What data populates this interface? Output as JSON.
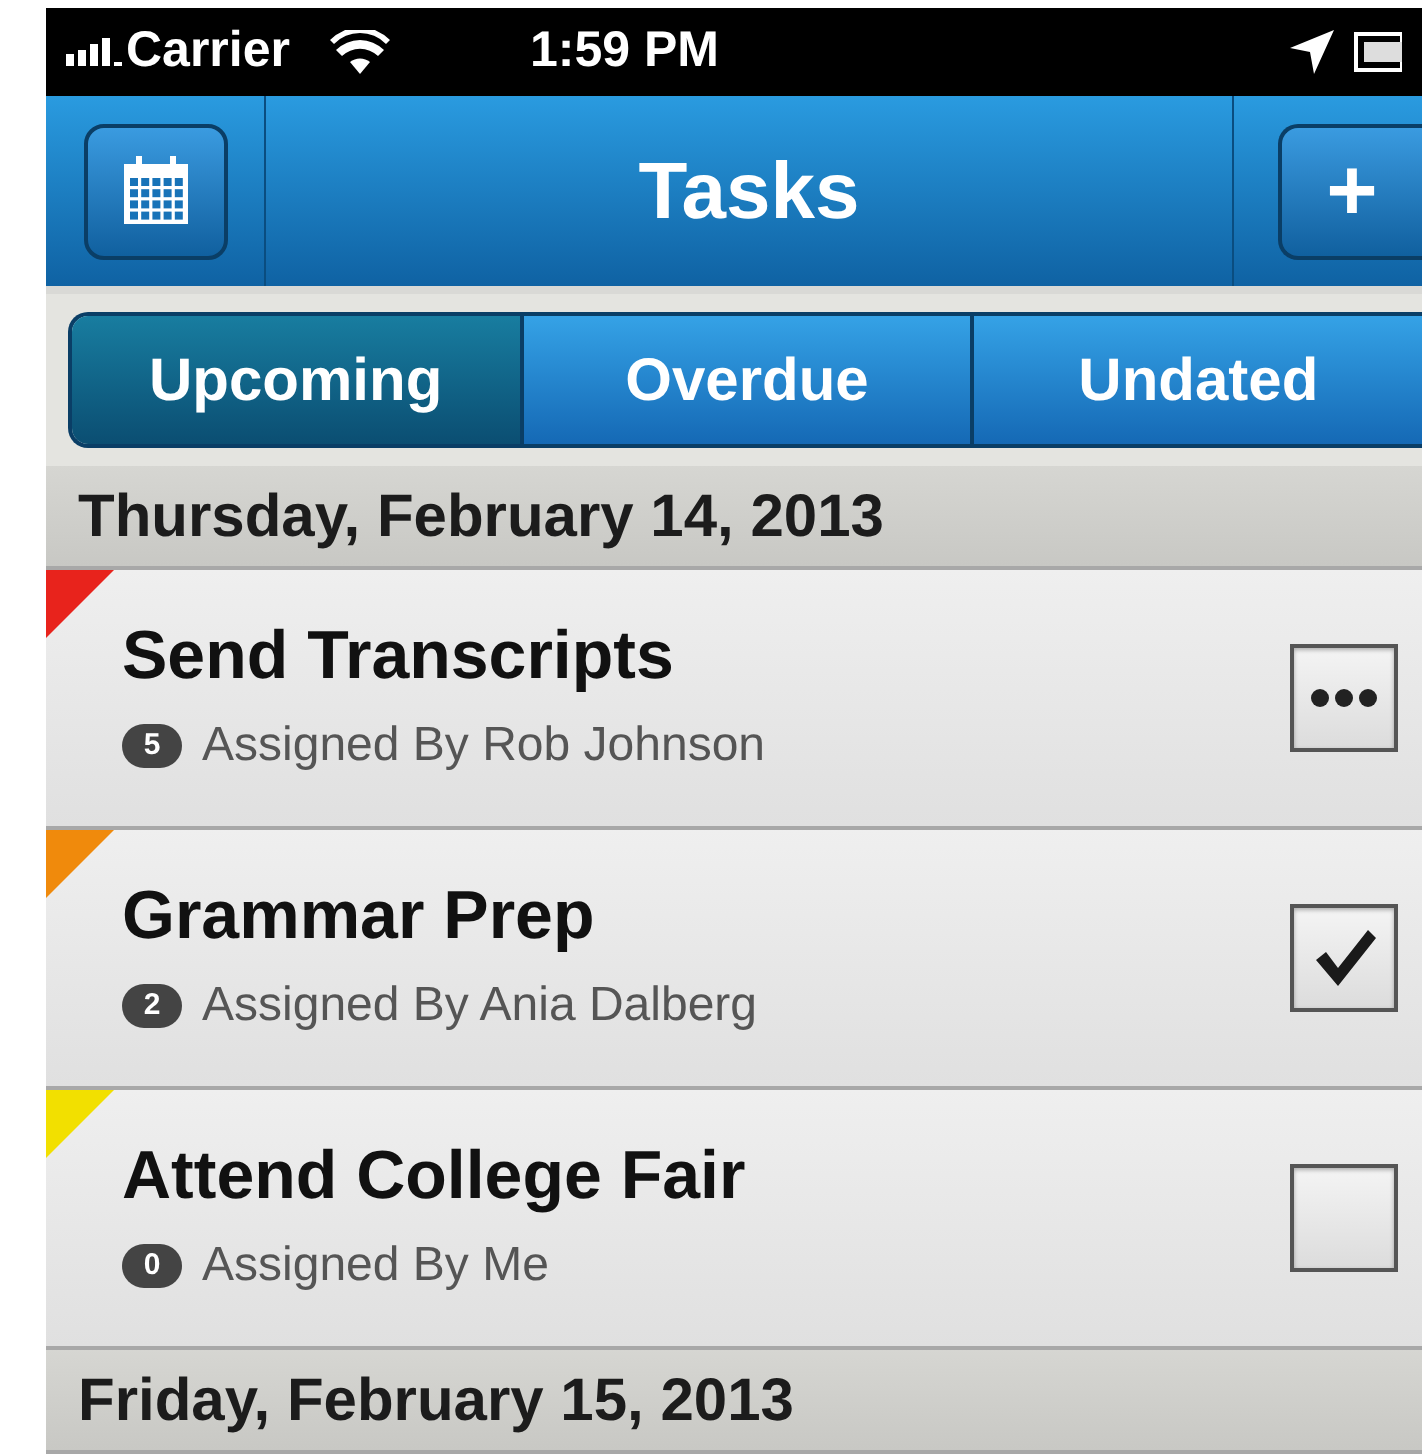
{
  "status_bar": {
    "carrier": "Carrier",
    "time": "1:59 PM"
  },
  "nav": {
    "title": "Tasks",
    "add_label": "+"
  },
  "tabs": [
    {
      "label": "Upcoming",
      "selected": true
    },
    {
      "label": "Overdue",
      "selected": false
    },
    {
      "label": "Undated",
      "selected": false
    }
  ],
  "sections": [
    {
      "date": "Thursday, February 14, 2013",
      "tasks": [
        {
          "title": "Send Transcripts",
          "comments": "5",
          "assigned": "Assigned By Rob Johnson",
          "color": "#e8231c",
          "kind": "progress"
        },
        {
          "title": "Grammar Prep",
          "comments": "2",
          "assigned": "Assigned By Ania Dalberg",
          "color": "#f08a0c",
          "kind": "checkbox",
          "checked": true
        },
        {
          "title": "Attend College Fair",
          "comments": "0",
          "assigned": "Assigned By Me",
          "color": "#f2e000",
          "kind": "checkbox",
          "checked": false
        }
      ]
    },
    {
      "date": "Friday, February 15, 2013"
    }
  ]
}
